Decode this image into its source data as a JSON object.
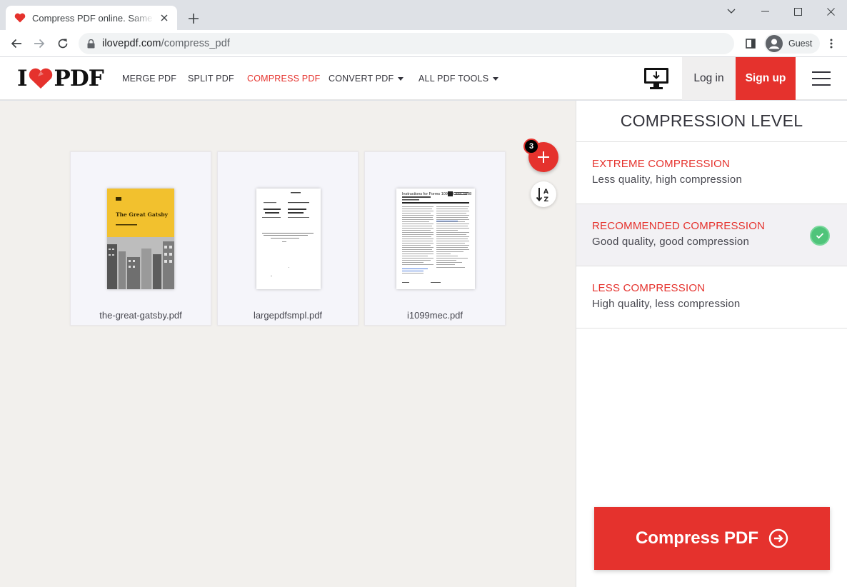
{
  "browser": {
    "tab_title": "Compress PDF online. Same PDF quality, less file size",
    "url_domain": "ilovepdf.com",
    "url_path": "/compress_pdf",
    "profile_label": "Guest"
  },
  "header": {
    "logo_left": "I",
    "logo_right": "PDF",
    "nav": [
      {
        "label": "MERGE PDF"
      },
      {
        "label": "SPLIT PDF"
      },
      {
        "label": "COMPRESS PDF"
      },
      {
        "label": "CONVERT PDF"
      },
      {
        "label": "ALL PDF TOOLS"
      }
    ],
    "login_label": "Log in",
    "signup_label": "Sign up"
  },
  "files": [
    {
      "name": "the-great-gatsby.pdf",
      "cover_title": "The Great Gatsby"
    },
    {
      "name": "largepdfsmpl.pdf"
    },
    {
      "name": "i1099mec.pdf",
      "cover_title": "Instructions for Forms 1099-R and 5498"
    }
  ],
  "file_count": "3",
  "sidebar": {
    "title": "COMPRESSION LEVEL",
    "options": [
      {
        "title": "EXTREME COMPRESSION",
        "desc": "Less quality, high compression",
        "selected": false
      },
      {
        "title": "RECOMMENDED COMPRESSION",
        "desc": "Good quality, good compression",
        "selected": true
      },
      {
        "title": "LESS COMPRESSION",
        "desc": "High quality, less compression",
        "selected": false
      }
    ],
    "action_label": "Compress PDF"
  },
  "colors": {
    "brand_red": "#e5322d",
    "check_green": "#4fc47a",
    "workarea_bg": "#f2f0ed"
  }
}
